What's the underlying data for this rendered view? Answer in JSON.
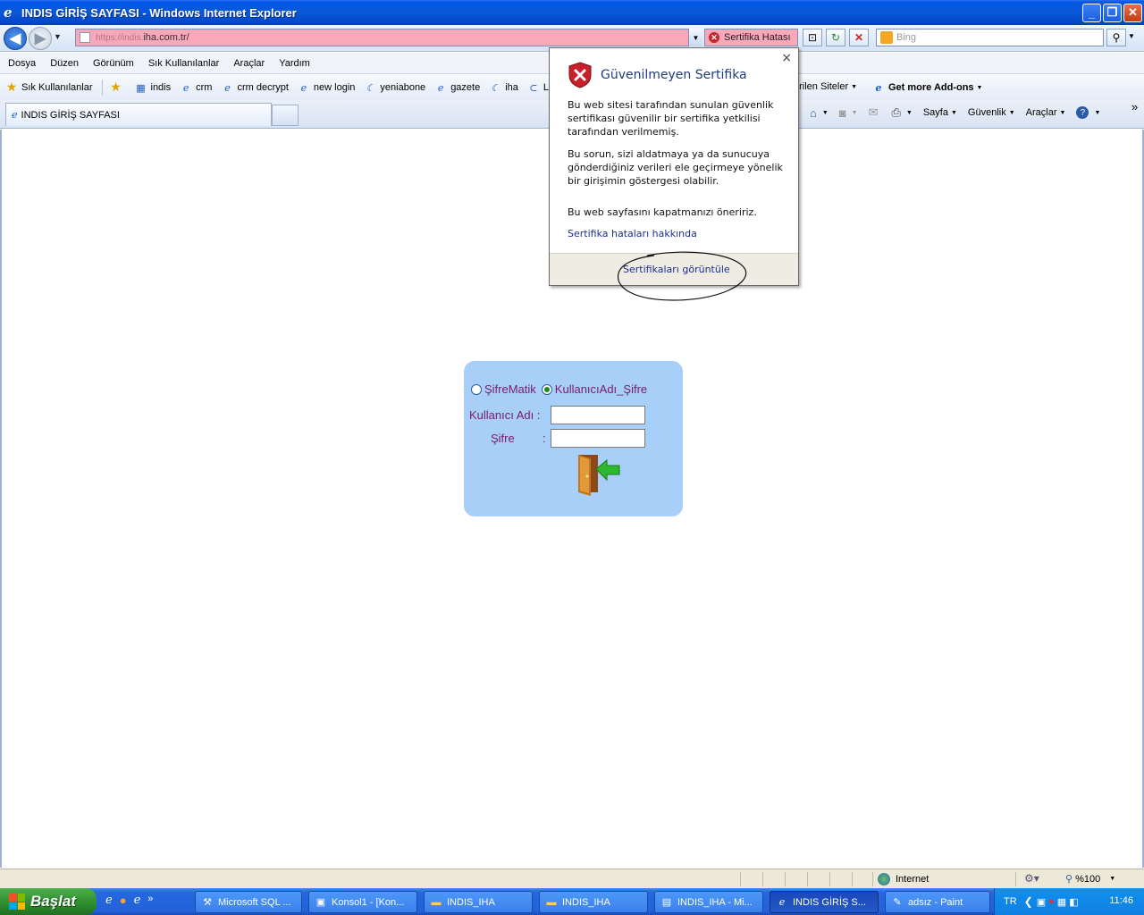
{
  "window": {
    "title": "INDIS GİRİŞ SAYFASI - Windows Internet Explorer",
    "minimize": "_",
    "maximize": "❐",
    "close": "✕"
  },
  "address": {
    "url_scheme": "https://indis.",
    "url_host": "iha.com.tr/",
    "cert_error": "Sertifika Hatası",
    "search_placeholder": "Bing"
  },
  "menu": [
    "Dosya",
    "Düzen",
    "Görünüm",
    "Sık Kullanılanlar",
    "Araçlar",
    "Yardım"
  ],
  "favorites": {
    "label": "Sık Kullanılanlar",
    "items": [
      "indis",
      "crm",
      "crm decrypt",
      "new login",
      "yeniabone",
      "gazete",
      "iha",
      "Logi"
    ],
    "suggested_sites": "erilen Siteler",
    "addons": "Get more Add-ons"
  },
  "tab": {
    "label": "INDIS GİRİŞ SAYFASI"
  },
  "commands": {
    "page": "Sayfa",
    "safety": "Güvenlik",
    "tools": "Araçlar"
  },
  "login": {
    "radio_1": "ŞifreMatik",
    "radio_2": "KullanıcıAdı_Şifre",
    "user_label": "Kullanıcı Adı :",
    "pass_label": "Şifre",
    "pass_colon": ":",
    "selected": "KullanıcıAdı_Şifre"
  },
  "cert_popup": {
    "title": "Güvenilmeyen Sertifika",
    "close": "×",
    "p1": "Bu web sitesi tarafından sunulan güvenlik sertifikası güvenilir bir sertifika yetkilisi tarafından verilmemiş.",
    "p2": "Bu sorun, sizi aldatmaya ya da sunucuya gönderdiğiniz verileri ele geçirmeye yönelik bir girişimin göstergesi olabilir.",
    "p3": "Bu web sayfasını kapatmanızı öneririz.",
    "link_errors": "Sertifika hataları hakkında",
    "link_view": "Sertifikaları görüntüle"
  },
  "status": {
    "zone": "Internet",
    "zoom": "%100"
  },
  "taskbar": {
    "start": "Başlat",
    "tasks": [
      "Microsoft SQL ...",
      "Konsol1 - [Kon...",
      "INDIS_IHA",
      "INDIS_IHA",
      "INDIS_IHA - Mi...",
      "INDIS GİRİŞ S...",
      "adsız - Paint"
    ],
    "active_task": "INDIS GİRİŞ S...",
    "lang": "TR",
    "clock": "11:46"
  }
}
